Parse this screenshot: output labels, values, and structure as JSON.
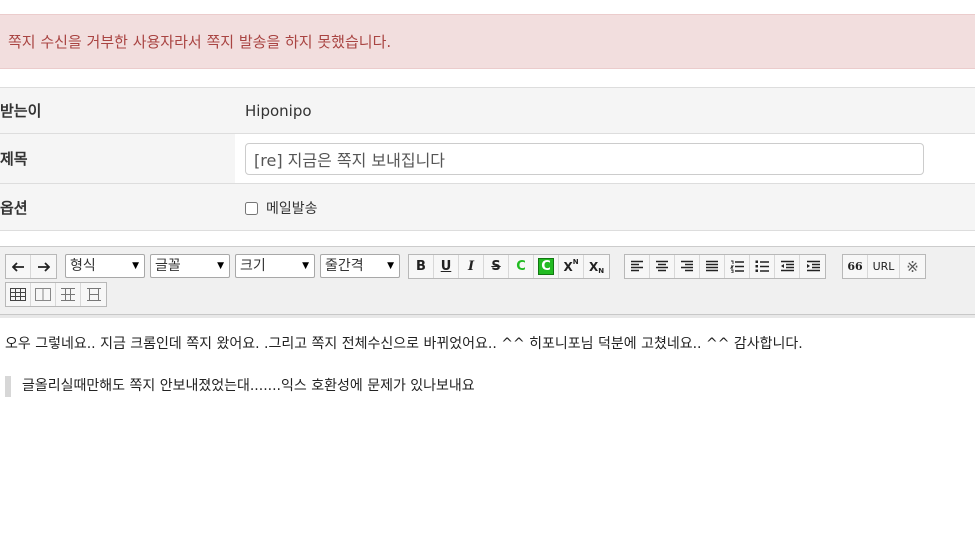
{
  "alert": {
    "message": "쪽지 수신을 거부한 사용자라서 쪽지 발송을 하지 못했습니다."
  },
  "form": {
    "to_label": "받는이",
    "to_value": "Hiponipo",
    "subject_label": "제목",
    "subject_value": "[re] 지금은 쪽지 보내집니다",
    "option_label": "옵션",
    "option_checkbox_label": "메일발송"
  },
  "toolbar": {
    "selects": {
      "format": "형식",
      "font": "글꼴",
      "size": "크기",
      "line_height": "줄간격"
    },
    "text_buttons": {
      "bold": "B",
      "underline": "U",
      "italic": "I",
      "strike": "S",
      "color": "C",
      "bgcolor": "C",
      "sup": "X",
      "sup_sub": "N",
      "sub": "X",
      "sub_sub": "N"
    },
    "misc": {
      "quote": "66",
      "url": "URL",
      "special": "※"
    }
  },
  "content": {
    "line1": "오우 그렇네요.. 지금 크롬인데 쪽지 왔어요. .그리고 쪽지 전체수신으로 바뀌었어요.. ^^ 히포니포님 덕분에 고쳤네요.. ^^ 감사합니다.",
    "quote": "글올리실때만해도 쪽지 안보내졌었는대.......익스 호환성에 문제가 있나보내요"
  },
  "colors": {
    "alert_bg": "#f2dede",
    "alert_text": "#a94442",
    "green": "#22bb22"
  }
}
